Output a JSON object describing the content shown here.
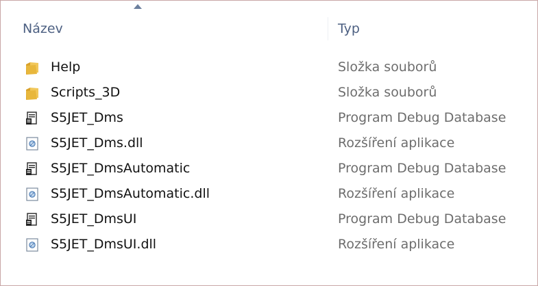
{
  "columns": {
    "name_label": "Název",
    "type_label": "Typ",
    "sort": "ascending"
  },
  "files": [
    {
      "name": "Help",
      "type": "Složka souborů",
      "icon": "folder-icon"
    },
    {
      "name": "Scripts_3D",
      "type": "Složka souborů",
      "icon": "folder-icon"
    },
    {
      "name": "S5JET_Dms",
      "type": "Program Debug Database",
      "icon": "pdb-file-icon"
    },
    {
      "name": "S5JET_Dms.dll",
      "type": "Rozšíření aplikace",
      "icon": "dll-file-icon"
    },
    {
      "name": "S5JET_DmsAutomatic",
      "type": "Program Debug Database",
      "icon": "pdb-file-icon"
    },
    {
      "name": "S5JET_DmsAutomatic.dll",
      "type": "Rozšíření aplikace",
      "icon": "dll-file-icon"
    },
    {
      "name": "S5JET_DmsUI",
      "type": "Program Debug Database",
      "icon": "pdb-file-icon"
    },
    {
      "name": "S5JET_DmsUI.dll",
      "type": "Rozšíření aplikace",
      "icon": "dll-file-icon"
    }
  ],
  "colors": {
    "header_text": "#4d6082",
    "name_text": "#111111",
    "type_text": "#6d6d6d",
    "folder": "#e8b73c"
  }
}
